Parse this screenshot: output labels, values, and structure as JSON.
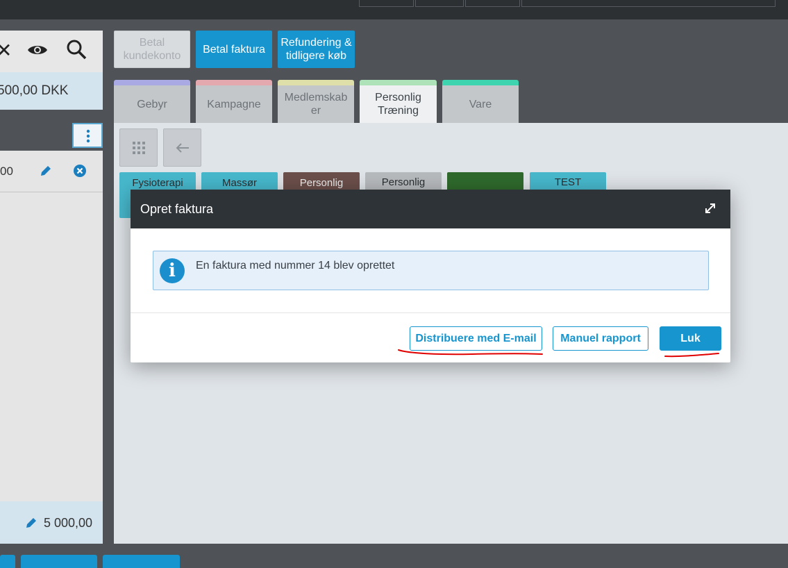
{
  "left_panel": {
    "amount": "500,00 DKK",
    "row_value": "00",
    "total_value": "5 000,00",
    "icons": [
      "close-icon",
      "eye-icon",
      "search-icon"
    ]
  },
  "actions": {
    "betal_kundekonto": "Betal kundekonto",
    "betal_faktura": "Betal faktura",
    "refundering": "Refundering & tidligere køb"
  },
  "tabs": [
    {
      "label": "Gebyr",
      "color": "#a9a9e4"
    },
    {
      "label": "Kampagne",
      "color": "#e4a9ae"
    },
    {
      "label": "Medlemskaber",
      "color": "#dfe0a9"
    },
    {
      "label": "Personlig Træning",
      "color": "#aee2b9",
      "active": true
    },
    {
      "label": "Vare",
      "color": "#3fd4b0"
    }
  ],
  "tiles": [
    {
      "label": "Fysioterapi",
      "color": "#47b8cc"
    },
    {
      "label": "Massør",
      "color": "#47b8cc"
    },
    {
      "label": "Personlig",
      "color": "#6b4f4a"
    },
    {
      "label": "Personlig",
      "color": "#b7babd"
    },
    {
      "label": "",
      "color": "#2f6a2c"
    },
    {
      "label": "TEST",
      "color": "#47b8cc"
    }
  ],
  "modal": {
    "title": "Opret faktura",
    "message": "En faktura med nummer 14 blev oprettet",
    "buttons": {
      "email": "Distribuere med E-mail",
      "manual": "Manuel rapport",
      "close": "Luk"
    },
    "info_icon_glyph": "i"
  },
  "colors": {
    "primary": "#1695cf",
    "header": "#2e3338",
    "annotation": "#e00000"
  }
}
